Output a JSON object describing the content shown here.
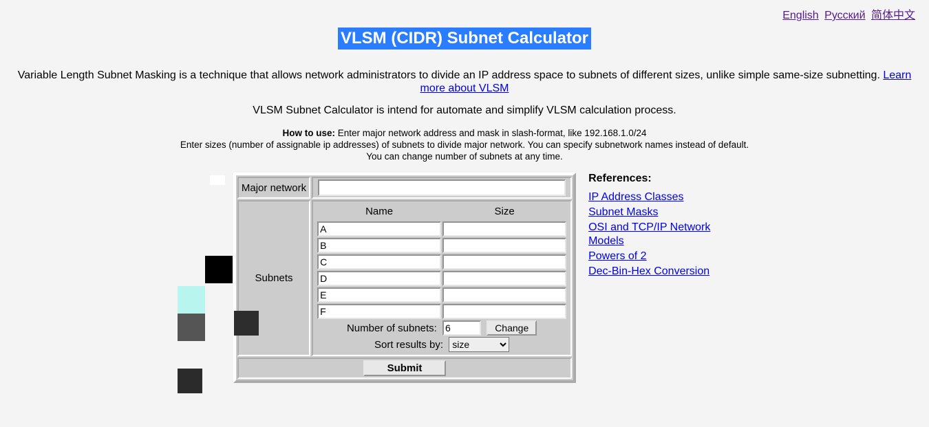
{
  "langs": {
    "en": "English",
    "ru": "Русский",
    "zh": "简体中文"
  },
  "title": "VLSM (CIDR) Subnet Calculator",
  "desc_pre": "Variable Length Subnet Masking is a technique that allows network administrators to divide an IP address space to subnets of different sizes, unlike simple same-size subnetting. ",
  "learn_more": "Learn more about VLSM",
  "sub": "VLSM Subnet Calculator is intend for automate and simplify VLSM calculation process.",
  "howto_label": "How to use:",
  "howto_l1": " Enter major network address and mask in slash-format, like 192.168.1.0/24",
  "howto_l2": "Enter sizes (number of assignable ip addresses) of subnets to divide major network. You can specify subnetwork names instead of default.",
  "howto_l3": "You can change number of subnets at any time.",
  "form": {
    "major_label": "Major network",
    "major_value": "",
    "subnets_label": "Subnets",
    "col_name": "Name",
    "col_size": "Size",
    "rows": [
      {
        "name": "A",
        "size": ""
      },
      {
        "name": "B",
        "size": ""
      },
      {
        "name": "C",
        "size": ""
      },
      {
        "name": "D",
        "size": ""
      },
      {
        "name": "E",
        "size": ""
      },
      {
        "name": "F",
        "size": ""
      }
    ],
    "num_label": "Number of subnets:",
    "num_value": "6",
    "change": "Change",
    "sort_label": "Sort results by:",
    "sort_value": "size",
    "submit": "Submit"
  },
  "refs": {
    "title": "References:",
    "links": [
      "IP Address Classes",
      "Subnet Masks",
      "OSI and TCP/IP Network Models",
      "Powers of 2",
      "Dec-Bin-Hex Conversion"
    ]
  }
}
